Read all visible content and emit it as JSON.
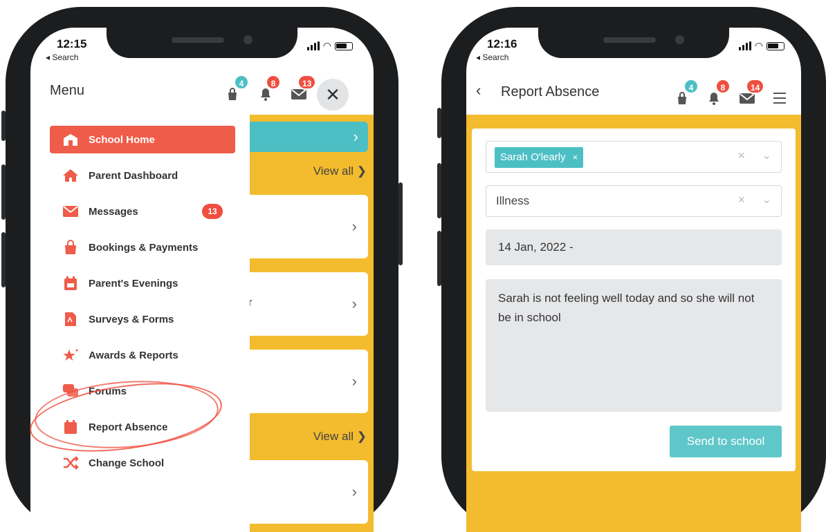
{
  "left_phone": {
    "status": {
      "time": "12:15",
      "back_label": "◂ Search"
    },
    "header": {
      "title": "Menu",
      "badges": {
        "bag": "4",
        "bell": "8",
        "mail": "13"
      },
      "close_symbol": "✕"
    },
    "menu_items": [
      {
        "label": "School Home",
        "icon": "school-icon",
        "active": true
      },
      {
        "label": "Parent Dashboard",
        "icon": "home-icon"
      },
      {
        "label": "Messages",
        "icon": "mail-icon",
        "badge": "13"
      },
      {
        "label": "Bookings & Payments",
        "icon": "shopping-bag-icon"
      },
      {
        "label": "Parent's Evenings",
        "icon": "calendar-icon"
      },
      {
        "label": "Surveys & Forms",
        "icon": "document-icon"
      },
      {
        "label": "Awards & Reports",
        "icon": "star-icon"
      },
      {
        "label": "Forums",
        "icon": "chat-icon"
      },
      {
        "label": "Report Absence",
        "icon": "calendar-icon"
      },
      {
        "label": "Change School",
        "icon": "shuffle-icon"
      }
    ],
    "background": {
      "view_all_1": "View all ❯",
      "view_all_2": "View all ❯",
      "fragment": "r",
      "chevron": "›"
    }
  },
  "right_phone": {
    "status": {
      "time": "12:16",
      "back_label": "◂ Search"
    },
    "header": {
      "back_symbol": "‹",
      "title": "Report Absence",
      "badges": {
        "bag": "4",
        "bell": "8",
        "mail": "14"
      }
    },
    "form": {
      "student_chip": "Sarah O'learly",
      "chip_remove": "×",
      "reason": "Illness",
      "clear_symbol": "×",
      "dropdown_symbol": "⌄",
      "date": "14 Jan, 2022 -",
      "message": "Sarah is not feeling well today and so she will not be in school",
      "submit_label": "Send to school"
    }
  },
  "colors": {
    "accent_red": "#ef5c4a",
    "teal": "#4cbfc4",
    "yellow_bg": "#f3bb2e"
  }
}
